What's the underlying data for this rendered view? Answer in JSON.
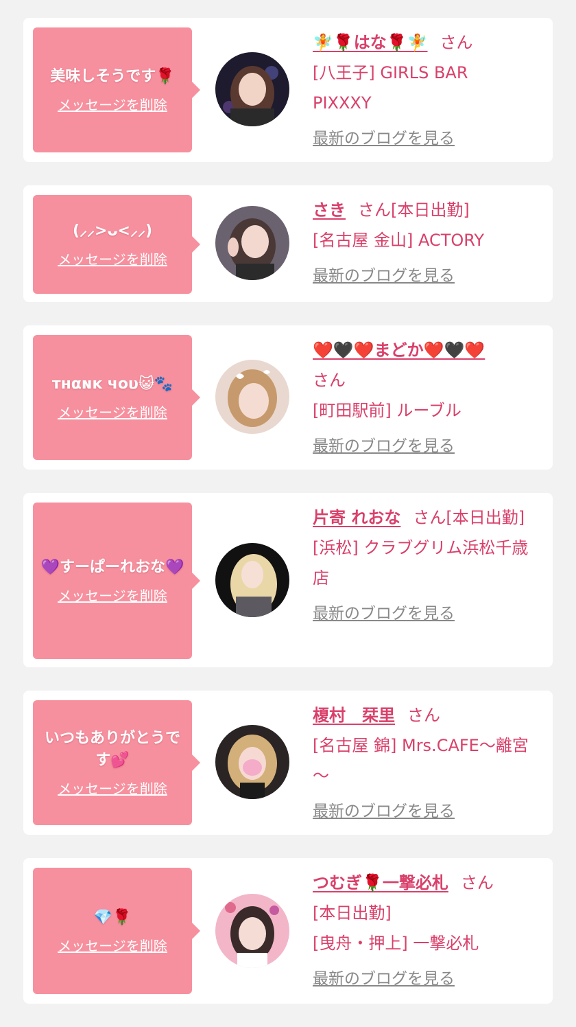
{
  "colors": {
    "page_bg": "#f2f2f2",
    "card_bg": "#ffffff",
    "bubble_bg": "#f7909e",
    "name_color": "#d9406a",
    "link_gray": "#888888"
  },
  "delete_label": "メッセージを削除",
  "blog_label": "最新のブログを見る",
  "san_label": "さん",
  "cards": [
    {
      "message": "美味しそうです🌹",
      "name": "🧚🌹はな🌹🧚",
      "status": "",
      "shop_lines": [
        "[八王子] GIRLS BAR",
        "PIXXXY"
      ],
      "avatar_icon": "avatar-photo"
    },
    {
      "message": "(⸝⸝>ᴗ<⸝⸝)",
      "name": "さき",
      "status": "[本日出勤]",
      "shop_lines": [
        "[名古屋 金山] ACTORY"
      ],
      "avatar_icon": "avatar-photo"
    },
    {
      "message": "тнαɴĸ чoυ😺🐾",
      "name": "❤️🖤❤️まどか❤️🖤❤️",
      "status": "",
      "shop_lines": [
        "[町田駅前] ルーブル"
      ],
      "avatar_icon": "avatar-photo"
    },
    {
      "message": "💜すーぱーれおな💜",
      "name": "片寄 れおな",
      "status": "[本日出勤]",
      "shop_lines": [
        "[浜松] クラブグリム浜松千歳店"
      ],
      "avatar_icon": "avatar-photo"
    },
    {
      "message": "いつもありがとうです💕",
      "name": "榎村　栞里",
      "status": "",
      "shop_lines": [
        "[名古屋 錦] Mrs.CAFE～離宮～"
      ],
      "avatar_icon": "avatar-photo"
    },
    {
      "message": "💎🌹",
      "name": "つむぎ🌹一撃必札",
      "status": "[本日出勤]",
      "shop_lines": [
        "[曳舟・押上] 一撃必札"
      ],
      "avatar_icon": "avatar-photo"
    }
  ]
}
